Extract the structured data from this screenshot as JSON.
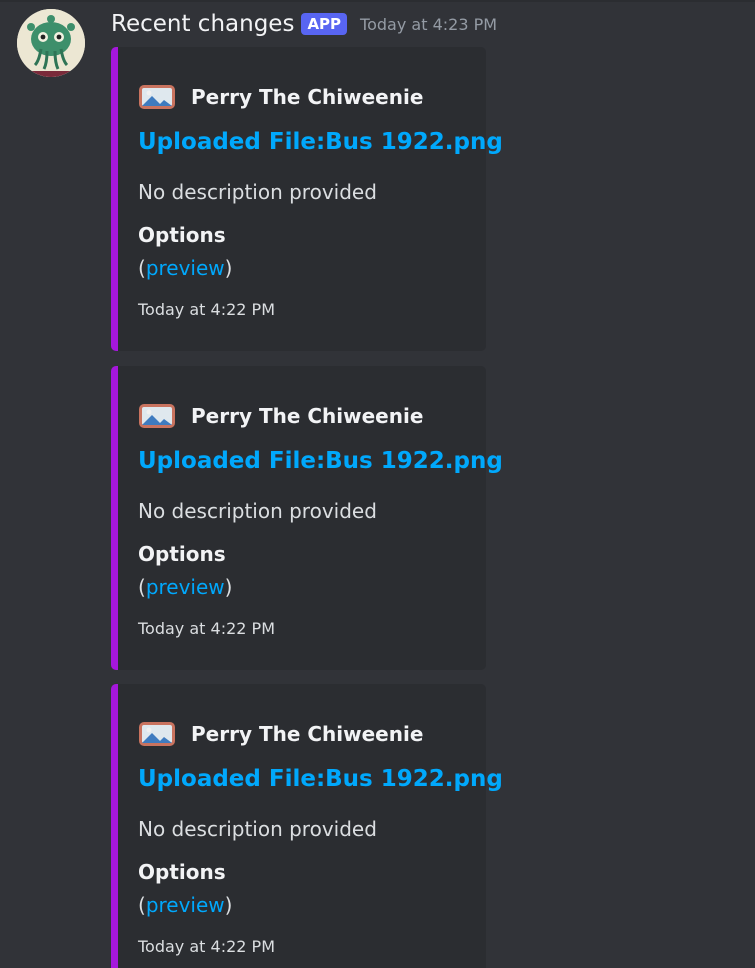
{
  "message": {
    "username": "Recent changes",
    "badge": "APP",
    "timestamp": "Today at 4:23 PM",
    "avatar_icon": "cthulhu-avatar-icon"
  },
  "colors": {
    "embed_accent": "#a517dc",
    "link": "#00a8fc",
    "badge_bg": "#5865f2",
    "background": "#313338",
    "embed_bg": "#2b2d31"
  },
  "embeds": [
    {
      "author_icon": "image-file-icon",
      "author": "Perry The Chiweenie",
      "title": "Uploaded File:Bus 1922.png",
      "description": "No description provided",
      "field_name": "Options",
      "field_value_open": "(",
      "field_value_link": "preview",
      "field_value_close": ")",
      "footer": "Today at 4:22 PM"
    },
    {
      "author_icon": "image-file-icon",
      "author": "Perry The Chiweenie",
      "title": "Uploaded File:Bus 1922.png",
      "description": "No description provided",
      "field_name": "Options",
      "field_value_open": "(",
      "field_value_link": "preview",
      "field_value_close": ")",
      "footer": "Today at 4:22 PM"
    },
    {
      "author_icon": "image-file-icon",
      "author": "Perry The Chiweenie",
      "title": "Uploaded File:Bus 1922.png",
      "description": "No description provided",
      "field_name": "Options",
      "field_value_open": "(",
      "field_value_link": "preview",
      "field_value_close": ")",
      "footer": "Today at 4:22 PM"
    }
  ]
}
